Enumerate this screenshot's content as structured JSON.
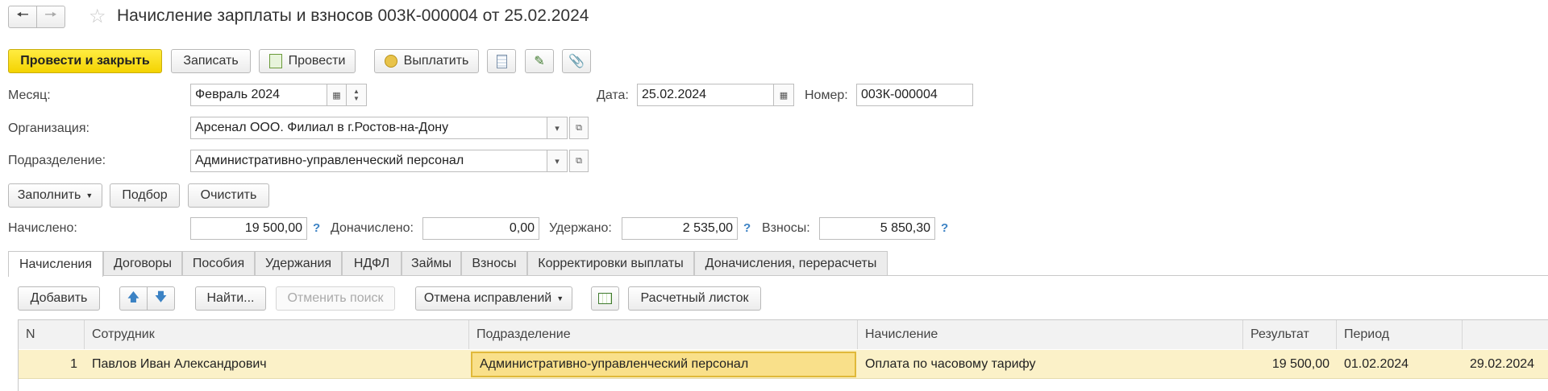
{
  "header": {
    "title": "Начисление зарплаты и взносов 003К-000004 от 25.02.2024"
  },
  "toolbar": {
    "post_close": "Провести и закрыть",
    "save": "Записать",
    "post": "Провести",
    "pay": "Выплатить"
  },
  "form": {
    "month_label": "Месяц:",
    "month_value": "Февраль 2024",
    "date_label": "Дата:",
    "date_value": "25.02.2024",
    "number_label": "Номер:",
    "number_value": "003К-000004",
    "org_label": "Организация:",
    "org_value": "Арсенал ООО. Филиал в г.Ростов-на-Дону",
    "dept_label": "Подразделение:",
    "dept_value": "Административно-управленческий персонал"
  },
  "actions": {
    "fill": "Заполнить",
    "select": "Подбор",
    "clear": "Очистить"
  },
  "totals": {
    "accrued_label": "Начислено:",
    "accrued_value": "19 500,00",
    "additional_label": "Доначислено:",
    "additional_value": "0,00",
    "withheld_label": "Удержано:",
    "withheld_value": "2 535,00",
    "contrib_label": "Взносы:",
    "contrib_value": "5 850,30",
    "help": "?"
  },
  "tabs": [
    {
      "label": "Начисления"
    },
    {
      "label": "Договоры"
    },
    {
      "label": "Пособия"
    },
    {
      "label": "Удержания"
    },
    {
      "label": "НДФЛ"
    },
    {
      "label": "Займы"
    },
    {
      "label": "Взносы"
    },
    {
      "label": "Корректировки выплаты"
    },
    {
      "label": "Доначисления, перерасчеты"
    }
  ],
  "table_toolbar": {
    "add": "Добавить",
    "find": "Найти...",
    "cancel_search": "Отменить поиск",
    "cancel_corrections": "Отмена исправлений",
    "payslip": "Расчетный листок"
  },
  "table": {
    "columns": [
      "N",
      "Сотрудник",
      "Подразделение",
      "Начисление",
      "Результат",
      "Период",
      ""
    ],
    "rows": [
      {
        "n": "1",
        "employee": "Павлов Иван Александрович",
        "dept": "Административно-управленческий персонал",
        "accrual": "Оплата по часовому тарифу",
        "result": "19 500,00",
        "period_start": "01.02.2024",
        "period_end": "29.02.2024"
      }
    ]
  },
  "colors": {
    "primary_button": "#f4d301",
    "selected_row": "#fbf1c8",
    "active_cell": "#f9e08a",
    "help_icon": "#3b82c4"
  }
}
